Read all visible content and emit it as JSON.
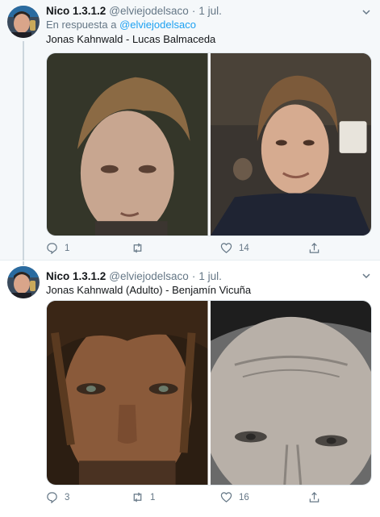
{
  "tweets": [
    {
      "author_name": "Nico 1.3.1.2",
      "author_handle": "@elviejodelsaco",
      "separator": "·",
      "time": "1 jul.",
      "reply_prefix": "En respuesta a",
      "reply_handle": "@elviejodelsaco",
      "text": "Jonas Kahnwald - Lucas Balmaceda",
      "reply_count": "1",
      "retweet_count": "",
      "like_count": "14"
    },
    {
      "author_name": "Nico 1.3.1.2",
      "author_handle": "@elviejodelsaco",
      "separator": "·",
      "time": "1 jul.",
      "text": "Jonas Kahnwald (Adulto) - Benjamín Vicuña",
      "reply_count": "3",
      "retweet_count": "1",
      "like_count": "16"
    }
  ],
  "icons": {
    "reply": "reply-icon",
    "retweet": "retweet-icon",
    "like": "heart-icon",
    "share": "share-icon",
    "caret": "chevron-down-icon"
  },
  "colors": {
    "link": "#1da1f2",
    "secondary_text": "#657786",
    "primary_text": "#14171a",
    "thread_line": "#ccd6dd"
  }
}
